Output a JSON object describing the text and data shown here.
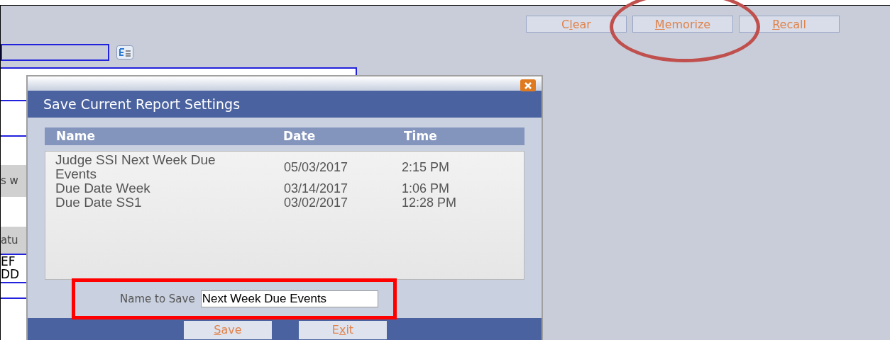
{
  "toolbar": {
    "buttons": [
      {
        "before": "C",
        "key": "l",
        "after": "ear"
      },
      {
        "key": "M",
        "after": "emorize"
      },
      {
        "key": "R",
        "after": "ecall"
      }
    ]
  },
  "background_fragments": [
    "s w",
    "atu",
    "EF",
    "DD"
  ],
  "dialog": {
    "title": "Save Current Report Settings",
    "columns": [
      "Name",
      "Date",
      "Time"
    ],
    "rows": [
      {
        "name": "Judge SSI Next Week Due Events",
        "date": "05/03/2017",
        "time": "2:15 PM"
      },
      {
        "name": "Due Date Week",
        "date": "03/14/2017",
        "time": "1:06 PM"
      },
      {
        "name": "Due Date SS1",
        "date": "03/02/2017",
        "time": "12:28 PM"
      }
    ],
    "name_label": "Name to Save",
    "name_value": "Next Week Due Events",
    "buttons": [
      {
        "key": "S",
        "after": "ave"
      },
      {
        "before": "E",
        "key": "x",
        "after": "it"
      }
    ]
  }
}
